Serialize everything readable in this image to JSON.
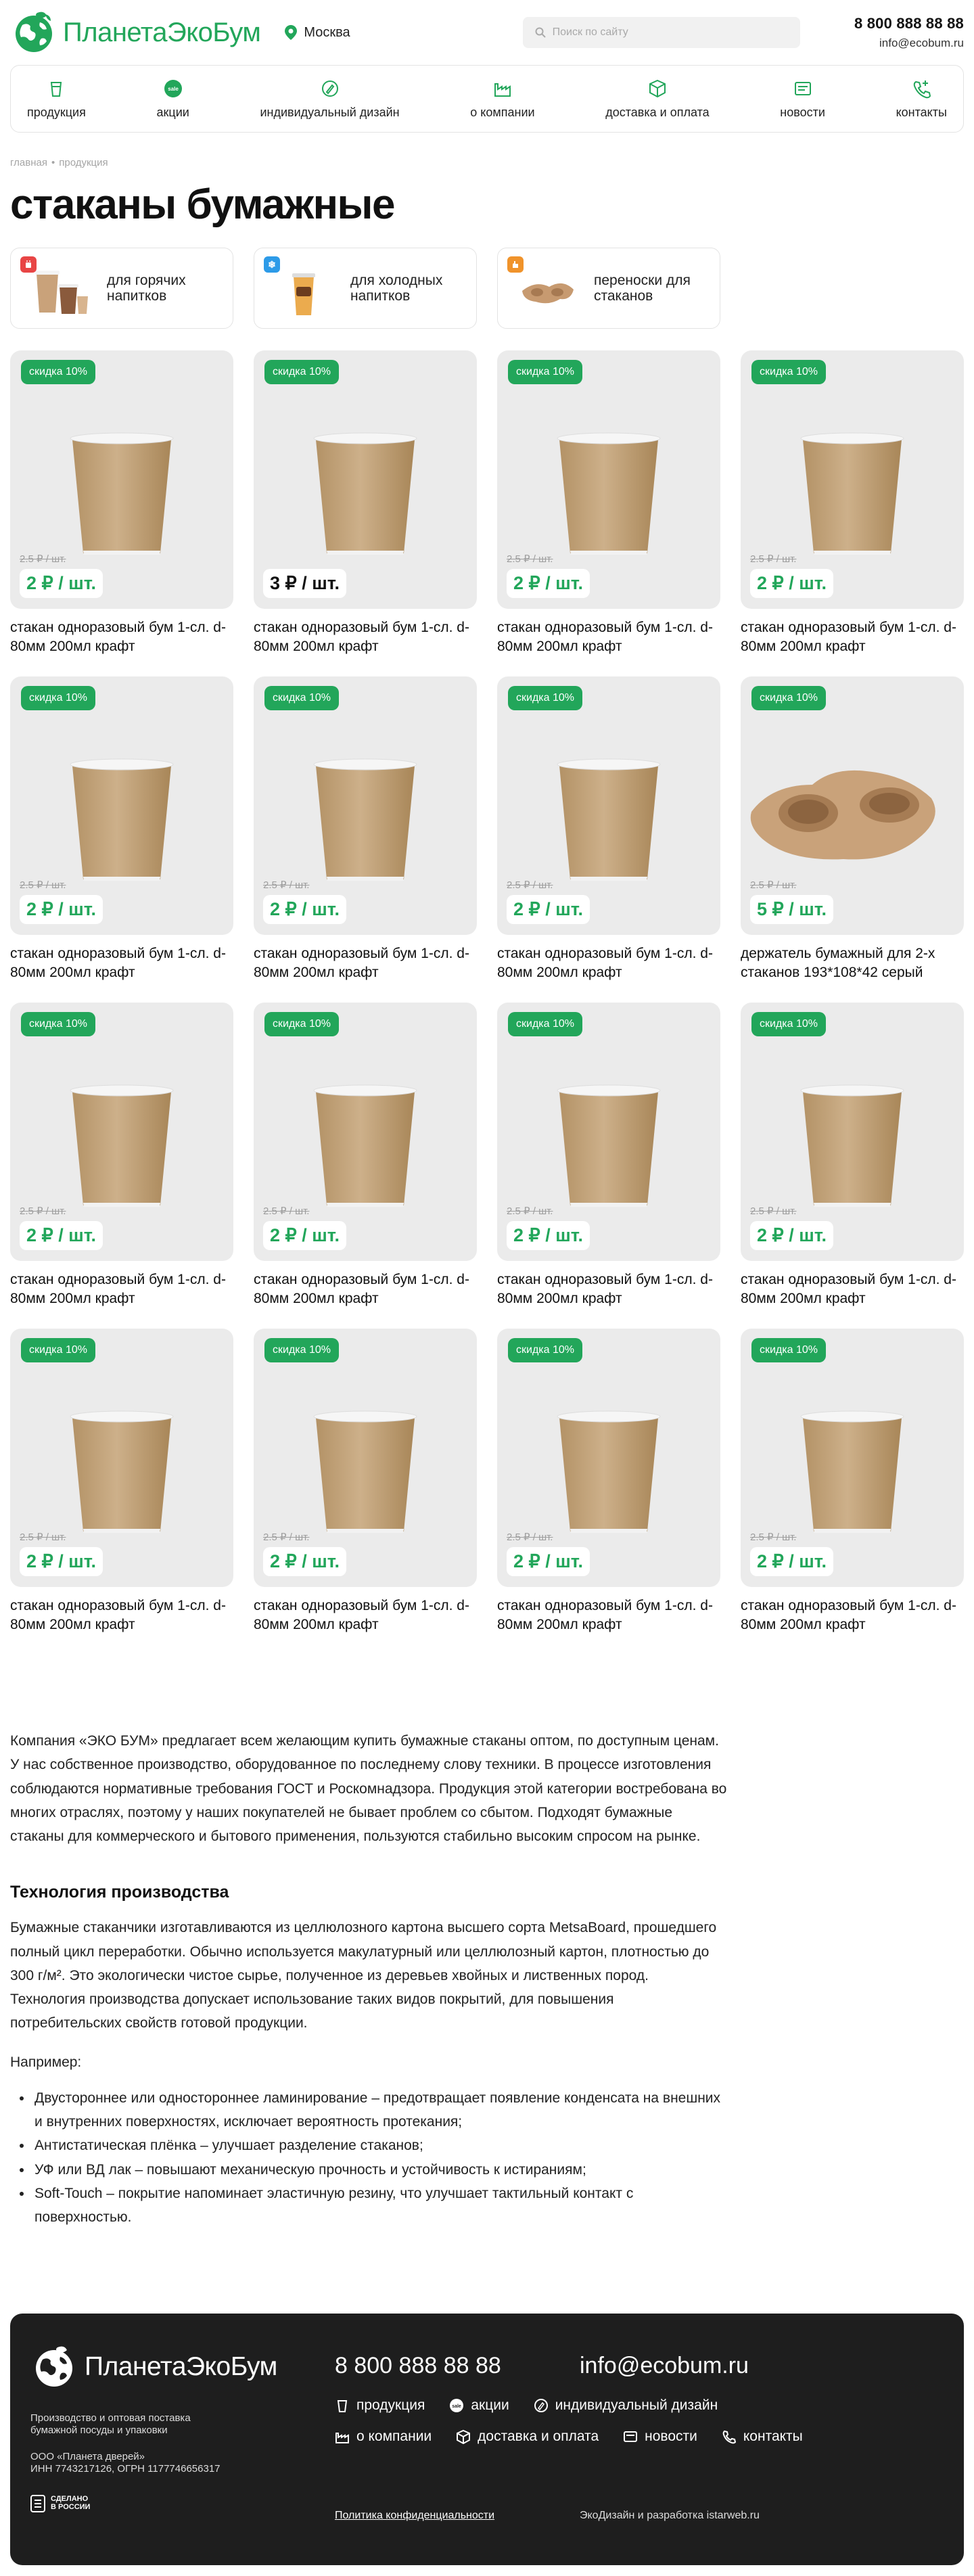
{
  "header": {
    "logo_text": "ПланетаЭкоБум",
    "city": "Москва",
    "search_placeholder": "Поиск по сайту",
    "phone": "8 800 888 88 88",
    "email": "info@ecobum.ru"
  },
  "nav": {
    "items": [
      {
        "label": "продукция",
        "icon": "cup-icon"
      },
      {
        "label": "акции",
        "icon": "sale-icon"
      },
      {
        "label": "индивидуальный дизайн",
        "icon": "design-icon"
      },
      {
        "label": "о компании",
        "icon": "factory-icon"
      },
      {
        "label": "доставка и оплата",
        "icon": "box-icon"
      },
      {
        "label": "новости",
        "icon": "news-icon"
      },
      {
        "label": "контакты",
        "icon": "phone-icon"
      }
    ]
  },
  "breadcrumb": {
    "home": "главная",
    "separator": "•",
    "current": "продукция"
  },
  "page_title": "стаканы бумажные",
  "categories": [
    {
      "label": "для горячих напитков",
      "badge_color": "#e84545"
    },
    {
      "label": "для холодных напитков",
      "badge_color": "#2d9be8"
    },
    {
      "label": "переноски для стаканов",
      "badge_color": "#f0932b"
    }
  ],
  "products": [
    {
      "sale": "скидка 10%",
      "old_price": "2.5 ₽ / шт.",
      "price": "2 ₽ / шт.",
      "name": "стакан одноразовый бум 1-сл. d-80мм 200мл крафт",
      "image": "cup"
    },
    {
      "sale": "скидка 10%",
      "old_price": "",
      "price": "3 ₽ / шт.",
      "name": "стакан одноразовый бум 1-сл. d-80мм 200мл крафт",
      "image": "cup"
    },
    {
      "sale": "скидка 10%",
      "old_price": "2.5 ₽ / шт.",
      "price": "2 ₽ / шт.",
      "name": "стакан одноразовый бум 1-сл. d-80мм 200мл крафт",
      "image": "cup"
    },
    {
      "sale": "скидка 10%",
      "old_price": "2.5 ₽ / шт.",
      "price": "2 ₽ / шт.",
      "name": "стакан одноразовый бум 1-сл. d-80мм 200мл крафт",
      "image": "cup"
    },
    {
      "sale": "скидка 10%",
      "old_price": "2.5 ₽ / шт.",
      "price": "2 ₽ / шт.",
      "name": "стакан одноразовый бум 1-сл. d-80мм 200мл крафт",
      "image": "cup"
    },
    {
      "sale": "скидка 10%",
      "old_price": "2.5 ₽ / шт.",
      "price": "2 ₽ / шт.",
      "name": "стакан одноразовый бум 1-сл. d-80мм 200мл крафт",
      "image": "cup"
    },
    {
      "sale": "скидка 10%",
      "old_price": "2.5 ₽ / шт.",
      "price": "2 ₽ / шт.",
      "name": "стакан одноразовый бум 1-сл. d-80мм 200мл крафт",
      "image": "cup"
    },
    {
      "sale": "скидка 10%",
      "old_price": "2.5 ₽ / шт.",
      "price": "5 ₽ / шт.",
      "name": "держатель бумажный для 2-х стаканов 193*108*42 серый",
      "image": "holder"
    },
    {
      "sale": "скидка 10%",
      "old_price": "2.5 ₽ / шт.",
      "price": "2 ₽ / шт.",
      "name": "стакан одноразовый бум 1-сл. d-80мм 200мл крафт",
      "image": "cup"
    },
    {
      "sale": "скидка 10%",
      "old_price": "2.5 ₽ / шт.",
      "price": "2 ₽ / шт.",
      "name": "стакан одноразовый бум 1-сл. d-80мм 200мл крафт",
      "image": "cup"
    },
    {
      "sale": "скидка 10%",
      "old_price": "2.5 ₽ / шт.",
      "price": "2 ₽ / шт.",
      "name": "стакан одноразовый бум 1-сл. d-80мм 200мл крафт",
      "image": "cup"
    },
    {
      "sale": "скидка 10%",
      "old_price": "2.5 ₽ / шт.",
      "price": "2 ₽ / шт.",
      "name": "стакан одноразовый бум 1-сл. d-80мм 200мл крафт",
      "image": "cup"
    },
    {
      "sale": "скидка 10%",
      "old_price": "2.5 ₽ / шт.",
      "price": "2 ₽ / шт.",
      "name": "стакан одноразовый бум 1-сл. d-80мм 200мл крафт",
      "image": "cup"
    },
    {
      "sale": "скидка 10%",
      "old_price": "2.5 ₽ / шт.",
      "price": "2 ₽ / шт.",
      "name": "стакан одноразовый бум 1-сл. d-80мм 200мл крафт",
      "image": "cup"
    },
    {
      "sale": "скидка 10%",
      "old_price": "2.5 ₽ / шт.",
      "price": "2 ₽ / шт.",
      "name": "стакан одноразовый бум 1-сл. d-80мм 200мл крафт",
      "image": "cup"
    },
    {
      "sale": "скидка 10%",
      "old_price": "2.5 ₽ / шт.",
      "price": "2 ₽ / шт.",
      "name": "стакан одноразовый бум 1-сл. d-80мм 200мл крафт",
      "image": "cup"
    }
  ],
  "seo": {
    "intro": "Компания «ЭКО БУМ» предлагает всем желающим купить бумажные стаканы оптом, по доступным ценам. У нас собственное производство, оборудованное по последнему слову техники. В процессе изготовления соблюдаются нормативные требования ГОСТ и Роскомнадзора. Продукция этой категории востребована во многих отраслях, поэтому у наших покупателей не бывает проблем со сбытом. Подходят бумажные стаканы для коммерческого и бытового применения, пользуются стабильно высоким спросом на рынке.",
    "heading": "Технология производства",
    "tech": "Бумажные стаканчики изготавливаются из целлюлозного картона высшего сорта MetsaBoard, прошедшего полный цикл переработки. Обычно используется макулатурный или целлюлозный картон, плотностью до 300 г/м². Это экологически чистое сырье, полученное из деревьев хвойных и лиственных пород. Технология производства допускает использование таких видов покрытий, для повышения потребительских свойств готовой продукции.",
    "example": "Например:",
    "bullets": [
      "Двустороннее или одностороннее ламинирование – предотвращает появление конденсата на внешних и внутренних поверхностях, исключает вероятность протекания;",
      "Антистатическая плёнка – улучшает разделение стаканов;",
      "УФ или ВД лак – повышают механическую прочность и устойчивость к истираниям;",
      "Soft-Touch – покрытие напоминает эластичную резину, что улучшает тактильный контакт с поверхностью."
    ]
  },
  "footer": {
    "logo_text": "ПланетаЭкоБум",
    "desc": "Производство и оптовая поставка бумажной посуды и упаковки",
    "legal_1": "ООО «Планета дверей»",
    "legal_2": "ИНН 7743217126, ОГРН 1177746656317",
    "made_1": "СДЕЛАНО",
    "made_2": "В РОССИИ",
    "phone": "8 800 888 88 88",
    "email": "info@ecobum.ru",
    "links_row1": [
      "продукция",
      "акции",
      "индивидуальный дизайн"
    ],
    "links_row2": [
      "о компании",
      "доставка и оплата",
      "новости",
      "контакты"
    ],
    "policy": "Политика конфиденциальности",
    "dev": "ЭкоДизайн и разработка istarweb.ru"
  }
}
